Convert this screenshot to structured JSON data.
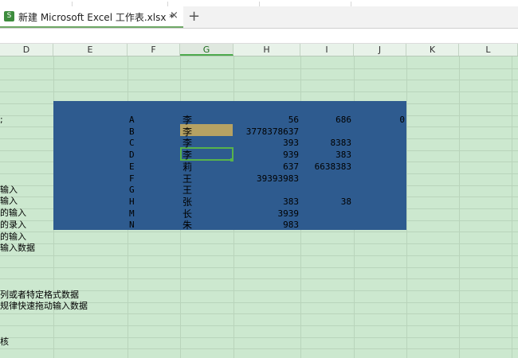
{
  "tab": {
    "title": "新建 Microsoft Excel 工作表.xlsx *",
    "icon_letter": "S",
    "close": "×",
    "new_tab": "+"
  },
  "columns": [
    "D",
    "E",
    "F",
    "G",
    "H",
    "I",
    "J",
    "K",
    "L"
  ],
  "active_column": "G",
  "rows": [
    {
      "f": "A",
      "g": "李",
      "h": "56",
      "i": "686",
      "j": "0"
    },
    {
      "f": "B",
      "g": "李",
      "h": "3778378637",
      "i": "",
      "j": ""
    },
    {
      "f": "C",
      "g": "李",
      "h": "393",
      "i": "8383",
      "j": ""
    },
    {
      "f": "D",
      "g": "李",
      "h": "939",
      "i": "383",
      "j": ""
    },
    {
      "f": "E",
      "g": "莉",
      "h": "637",
      "i": "6638383",
      "j": ""
    },
    {
      "f": "F",
      "g": "王",
      "h": "39393983",
      "i": "",
      "j": ""
    },
    {
      "f": "G",
      "g": "王",
      "h": "",
      "i": "",
      "j": ""
    },
    {
      "f": "H",
      "g": "张",
      "h": "383",
      "i": "38",
      "j": ""
    },
    {
      "f": "M",
      "g": "长",
      "h": "3939",
      "i": "",
      "j": ""
    },
    {
      "f": "N",
      "g": "朱",
      "h": "983",
      "i": "",
      "j": ""
    }
  ],
  "left_column_texts": [
    ";",
    "输入",
    "输入",
    "的输入",
    "的录入",
    "的输入",
    "输入数据",
    "列或者特定格式数据",
    "规律快速拖动输入数据",
    "核"
  ],
  "colors": {
    "sheet_bg": "#cce8cf",
    "block_bg": "#2e5b8f",
    "highlight_cell": "#b6a263",
    "selection_border": "#58b34b"
  }
}
